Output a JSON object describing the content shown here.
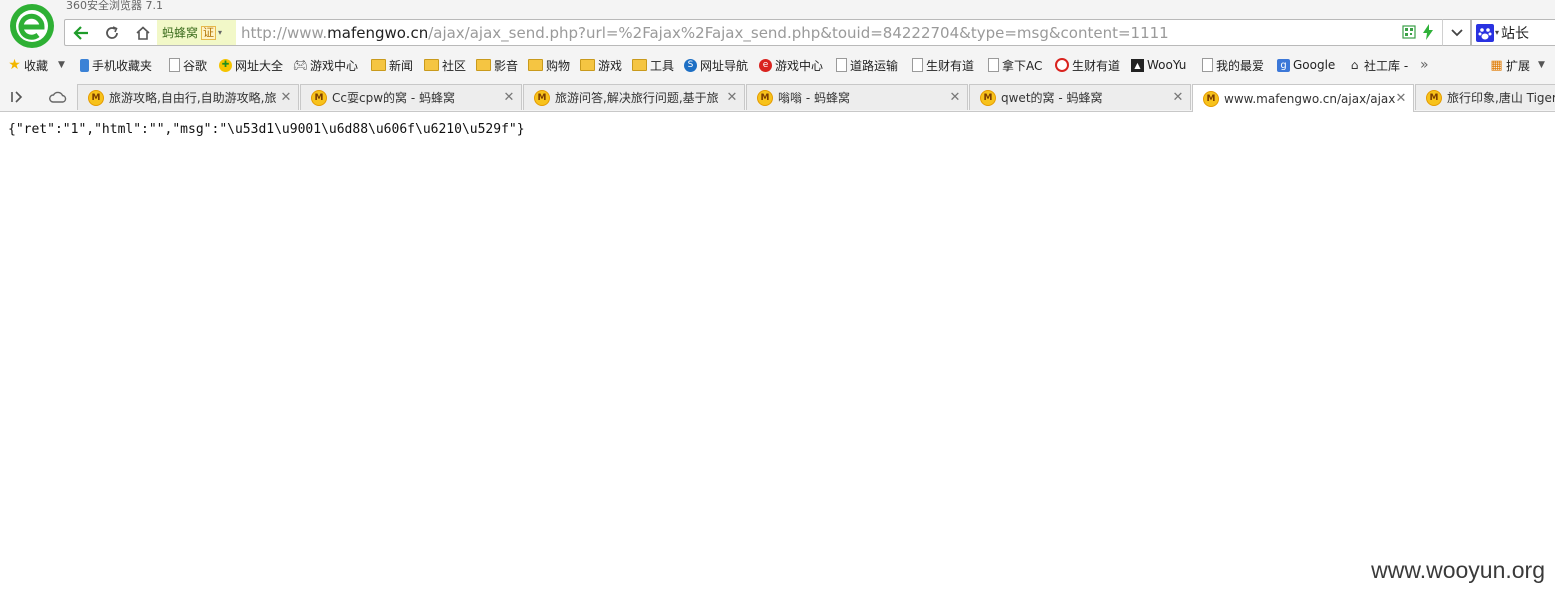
{
  "window": {
    "title": "360安全浏览器 7.1"
  },
  "colors": {
    "logo": "#2eb034",
    "cert_bg": "#f2f8c8",
    "tab_favicon": "#f7c21b"
  },
  "address_bar": {
    "cert_name": "蚂蜂窝",
    "cert_badge": "证",
    "url_scheme": "http://www.",
    "url_host": "mafengwo.cn",
    "url_path": "/ajax/ajax_send.php?url=%2Fajax%2Fajax_send.php&touid=84222704&type=msg&content=1111",
    "search_label": "站长"
  },
  "bookmarks": {
    "favorites_label": "收藏",
    "items": [
      {
        "label": "手机收藏夹",
        "icon": "phone-icon"
      },
      {
        "label": "谷歌",
        "icon": "page-icon"
      },
      {
        "label": "网址大全",
        "icon": "site-icon"
      },
      {
        "label": "游戏中心",
        "icon": "gamepad-icon"
      },
      {
        "label": "新闻",
        "icon": "folder-icon"
      },
      {
        "label": "社区",
        "icon": "folder-icon"
      },
      {
        "label": "影音",
        "icon": "folder-icon"
      },
      {
        "label": "购物",
        "icon": "folder-icon"
      },
      {
        "label": "游戏",
        "icon": "folder-icon"
      },
      {
        "label": "工具",
        "icon": "folder-icon"
      },
      {
        "label": "网址导航",
        "icon": "nav-icon"
      },
      {
        "label": "游戏中心",
        "icon": "game-center-icon"
      },
      {
        "label": "道路运输",
        "icon": "page-icon"
      },
      {
        "label": "生财有道",
        "icon": "page-icon"
      },
      {
        "label": "拿下AC",
        "icon": "page-icon"
      },
      {
        "label": "生财有道",
        "icon": "wheel-icon"
      },
      {
        "label": "WooYu",
        "icon": "wooyun-icon"
      },
      {
        "label": "我的最爱",
        "icon": "page-icon"
      },
      {
        "label": "Google",
        "icon": "google-icon"
      },
      {
        "label": "社工库 -",
        "icon": "lock-icon"
      }
    ],
    "more": "»",
    "extensions_label": "扩展"
  },
  "tabs": [
    {
      "title": "旅游攻略,自由行,自助游攻略,旅",
      "favicon": "M",
      "active": false
    },
    {
      "title": "Cc耍cpw的窝 - 蚂蜂窝",
      "favicon": "M",
      "active": false
    },
    {
      "title": "旅游问答,解决旅行问题,基于旅",
      "favicon": "M",
      "active": false
    },
    {
      "title": "嗡嗡 - 蚂蜂窝",
      "favicon": "M",
      "active": false
    },
    {
      "title": "qwet的窝 - 蚂蜂窝",
      "favicon": "M",
      "active": false
    },
    {
      "title": "www.mafengwo.cn/ajax/ajax_",
      "favicon": "M",
      "active": true
    },
    {
      "title": "旅行印象,唐山 Tiger",
      "favicon": "M",
      "active": false
    }
  ],
  "page": {
    "body": "{\"ret\":\"1\",\"html\":\"\",\"msg\":\"\\u53d1\\u9001\\u6d88\\u606f\\u6210\\u529f\"}"
  },
  "watermark": "www.wooyun.org"
}
